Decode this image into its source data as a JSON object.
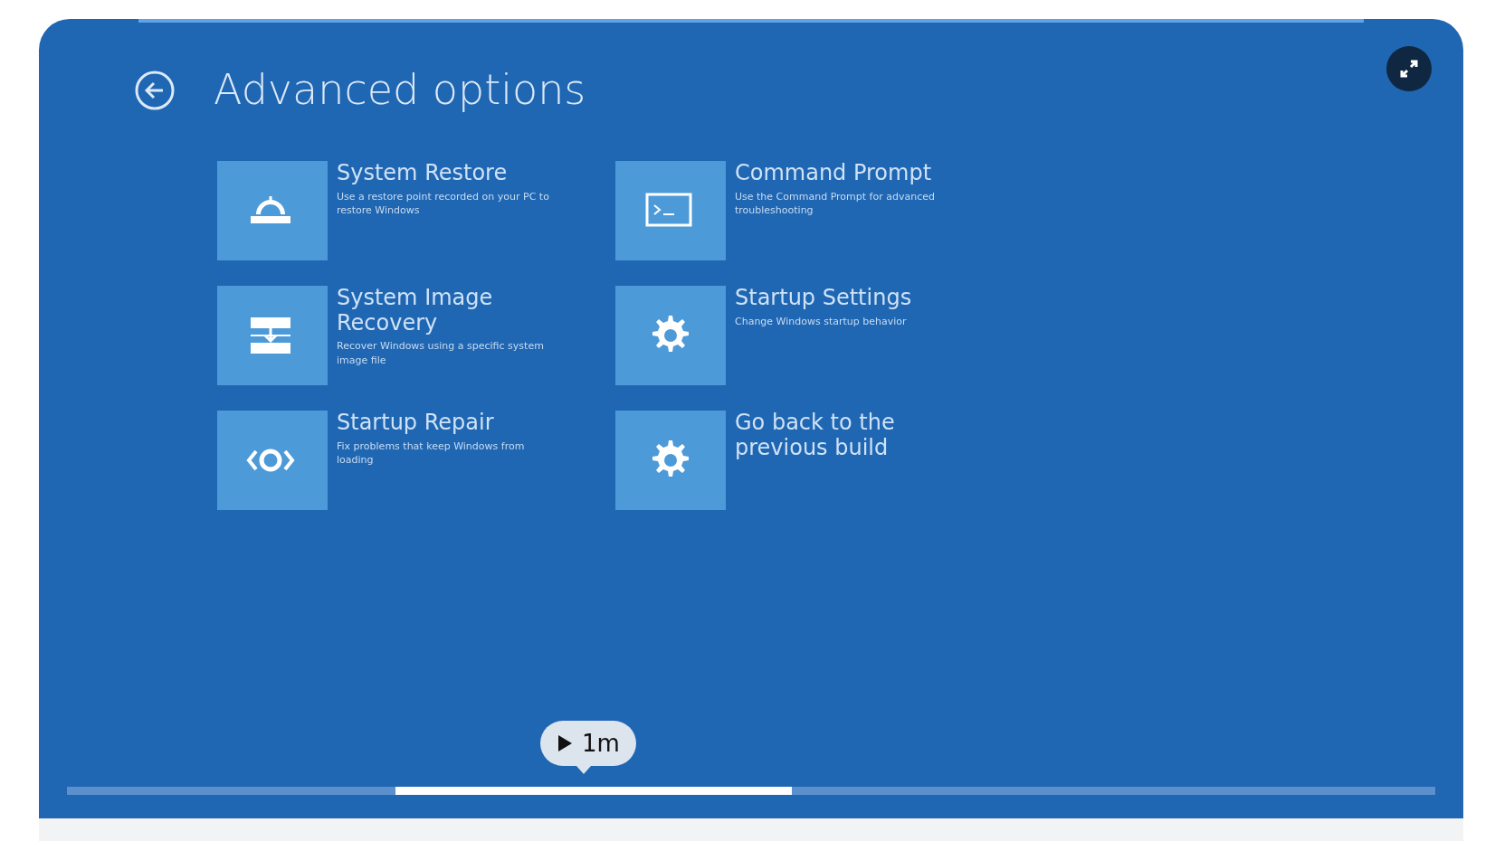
{
  "video": {
    "screen_title": "Advanced options",
    "options": [
      {
        "title": "System Restore",
        "description": "Use a restore point recorded on your PC to restore Windows",
        "kind": "restore"
      },
      {
        "title": "Command Prompt",
        "description": "Use the Command Prompt for advanced troubleshooting",
        "kind": "cmd"
      },
      {
        "title": "System Image Recovery",
        "description": "Recover Windows using a specific system image file",
        "kind": "image"
      },
      {
        "title": "Startup Settings",
        "description": "Change Windows startup behavior",
        "kind": "gear"
      },
      {
        "title": "Startup Repair",
        "description": "Fix problems that keep Windows from loading",
        "kind": "repair"
      },
      {
        "title": "Go back to the previous build",
        "kind": "gear"
      }
    ],
    "play_badge": {
      "label": "1m"
    },
    "segments": [
      {
        "selected": false
      },
      {
        "selected": true
      },
      {
        "selected": false
      }
    ]
  }
}
